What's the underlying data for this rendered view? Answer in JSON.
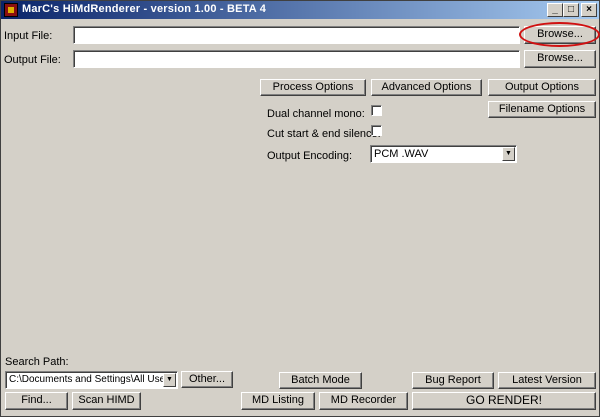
{
  "window": {
    "title": "MarC's HiMdRenderer - version 1.00 - BETA 4",
    "minimize_glyph": "_",
    "maximize_glyph": "□",
    "close_glyph": "×"
  },
  "input": {
    "label": "Input File:",
    "value": "",
    "browse_label": "Browse..."
  },
  "output": {
    "label": "Output File:",
    "value": "",
    "browse_label": "Browse..."
  },
  "options": {
    "process_label": "Process Options",
    "advanced_label": "Advanced Options",
    "output_label": "Output Options",
    "filename_label": "Filename Options"
  },
  "settings": {
    "dual_mono_label": "Dual channel mono:",
    "dual_mono_checked": false,
    "cut_silence_label": "Cut start & end silence:",
    "cut_silence_checked": false,
    "encoding_label": "Output Encoding:",
    "encoding_value": "PCM .WAV"
  },
  "search": {
    "label": "Search Path:",
    "path_value": "C:\\Documents and Settings\\All Users\\S",
    "other_label": "Other...",
    "find_label": "Find...",
    "scan_label": "Scan HIMD"
  },
  "bottom": {
    "batch_label": "Batch Mode",
    "bug_label": "Bug Report",
    "latest_label": "Latest Version",
    "listing_label": "MD Listing",
    "recorder_label": "MD Recorder",
    "render_label": "GO RENDER!"
  },
  "annotation": {
    "color": "#d01010"
  }
}
